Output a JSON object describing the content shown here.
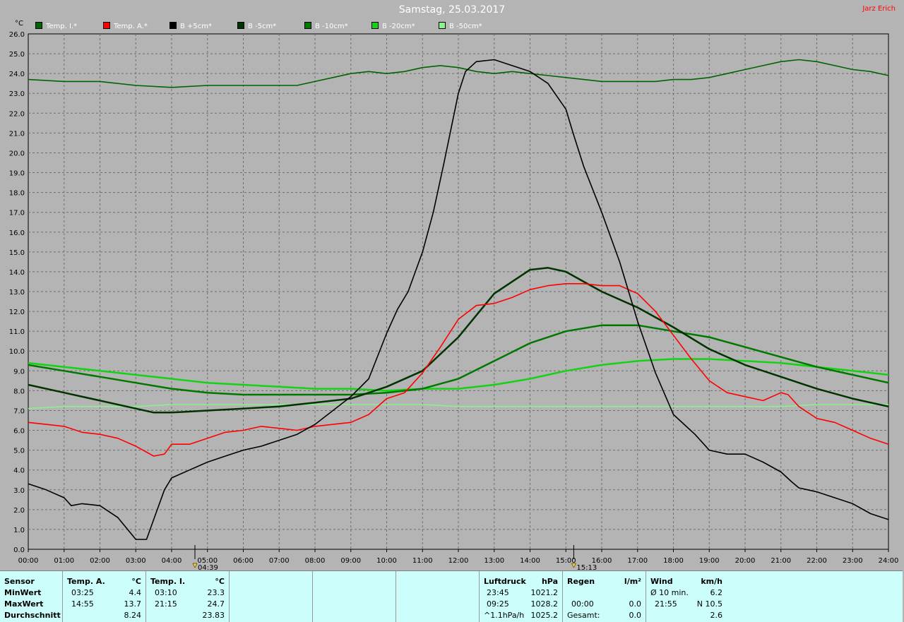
{
  "header": {
    "title": "Samstag, 25.03.2017",
    "author": "Jarz Erich"
  },
  "legend": [
    {
      "name": "Temp. I.*",
      "color": "#006400"
    },
    {
      "name": "Temp. A.*",
      "color": "#ff0000"
    },
    {
      "name": "B +5cm*",
      "color": "#000000"
    },
    {
      "name": "B -5cm*",
      "color": "#003300"
    },
    {
      "name": "B -10cm*",
      "color": "#007800"
    },
    {
      "name": "B -20cm*",
      "color": "#14d214"
    },
    {
      "name": "B -50cm*",
      "color": "#8cf08c"
    }
  ],
  "chart_data": {
    "type": "line",
    "ylabel": "°C",
    "ylim": [
      0,
      26
    ],
    "xlim": [
      0,
      24
    ],
    "grid": true,
    "y_ticks": [
      "0.0",
      "1.0",
      "2.0",
      "3.0",
      "4.0",
      "5.0",
      "6.0",
      "7.0",
      "8.0",
      "9.0",
      "10.0",
      "11.0",
      "12.0",
      "13.0",
      "14.0",
      "15.0",
      "16.0",
      "17.0",
      "18.0",
      "19.0",
      "20.0",
      "21.0",
      "22.0",
      "23.0",
      "24.0",
      "25.0",
      "26.0"
    ],
    "x_ticks": [
      "00:00",
      "01:00",
      "02:00",
      "03:00",
      "04:00",
      "05:00",
      "06:00",
      "07:00",
      "08:00",
      "09:00",
      "10:00",
      "11:00",
      "12:00",
      "13:00",
      "14:00",
      "15:00",
      "16:00",
      "17:00",
      "18:00",
      "19:00",
      "20:00",
      "21:00",
      "22:00",
      "23:00",
      "24:00"
    ],
    "markers": [
      {
        "label": "04:39",
        "x": 4.65,
        "icon": "sunrise-icon"
      },
      {
        "label": "15:13",
        "x": 15.22,
        "icon": "sunset-icon"
      }
    ],
    "series": [
      {
        "name": "Temp. I.*",
        "color": "#006400",
        "x": [
          0,
          1,
          2,
          3,
          4,
          5,
          6,
          7,
          7.5,
          8,
          8.5,
          9,
          9.5,
          10,
          10.5,
          11,
          11.5,
          12,
          12.5,
          13,
          13.5,
          14,
          14.5,
          15,
          15.5,
          16,
          16.5,
          17,
          17.5,
          18,
          18.5,
          19,
          19.5,
          20,
          20.5,
          21,
          21.5,
          22,
          22.5,
          23,
          23.5,
          24
        ],
        "y": [
          23.7,
          23.6,
          23.6,
          23.4,
          23.3,
          23.4,
          23.4,
          23.4,
          23.4,
          23.6,
          23.8,
          24.0,
          24.1,
          24.0,
          24.1,
          24.3,
          24.4,
          24.3,
          24.1,
          24.0,
          24.1,
          24.0,
          23.9,
          23.8,
          23.7,
          23.6,
          23.6,
          23.6,
          23.6,
          23.7,
          23.7,
          23.8,
          24.0,
          24.2,
          24.4,
          24.6,
          24.7,
          24.6,
          24.4,
          24.2,
          24.1,
          23.9
        ]
      },
      {
        "name": "Temp. A.*",
        "color": "#ff0000",
        "x": [
          0,
          0.5,
          1,
          1.5,
          2,
          2.5,
          3,
          3.5,
          3.8,
          4,
          4.5,
          5,
          5.5,
          6,
          6.5,
          7,
          7.5,
          8,
          8.5,
          9,
          9.5,
          10,
          10.5,
          11,
          11.5,
          12,
          12.5,
          13,
          13.5,
          14,
          14.5,
          15,
          15.5,
          16,
          16.5,
          17,
          17.5,
          18,
          18.5,
          19,
          19.5,
          20,
          20.5,
          21,
          21.2,
          21.5,
          22,
          22.5,
          23,
          23.5,
          24
        ],
        "y": [
          6.4,
          6.3,
          6.2,
          5.9,
          5.8,
          5.6,
          5.2,
          4.7,
          4.8,
          5.3,
          5.3,
          5.6,
          5.9,
          6.0,
          6.2,
          6.1,
          6.0,
          6.2,
          6.3,
          6.4,
          6.8,
          7.6,
          7.9,
          8.9,
          10.2,
          11.6,
          12.3,
          12.4,
          12.7,
          13.1,
          13.3,
          13.4,
          13.4,
          13.3,
          13.3,
          12.9,
          12.0,
          10.8,
          9.6,
          8.5,
          7.9,
          7.7,
          7.5,
          7.9,
          7.8,
          7.2,
          6.6,
          6.4,
          6.0,
          5.6,
          5.3
        ]
      },
      {
        "name": "B +5cm*",
        "color": "#000000",
        "x": [
          0,
          0.5,
          1,
          1.2,
          1.5,
          2,
          2.5,
          3,
          3.3,
          3.5,
          3.8,
          4,
          4.5,
          5,
          5.5,
          6,
          6.5,
          7,
          7.5,
          8,
          8.5,
          9,
          9.5,
          10,
          10.3,
          10.6,
          11,
          11.3,
          11.6,
          12,
          12.2,
          12.5,
          13,
          13.5,
          14,
          14.5,
          15,
          15.2,
          15.5,
          16,
          16.5,
          17,
          17.5,
          18,
          18.3,
          18.6,
          19,
          19.5,
          20,
          20.5,
          21,
          21.3,
          21.5,
          22,
          22.5,
          23,
          23.5,
          24
        ],
        "y": [
          3.3,
          3.0,
          2.6,
          2.2,
          2.3,
          2.2,
          1.6,
          0.5,
          0.5,
          1.5,
          3.0,
          3.6,
          4.0,
          4.4,
          4.7,
          5.0,
          5.2,
          5.5,
          5.8,
          6.3,
          7.0,
          7.7,
          8.6,
          10.9,
          12.1,
          13.0,
          15.0,
          17.0,
          19.5,
          23.0,
          24.1,
          24.6,
          24.7,
          24.4,
          24.1,
          23.5,
          22.2,
          21.0,
          19.3,
          17.0,
          14.5,
          11.5,
          8.9,
          6.8,
          6.3,
          5.8,
          5.0,
          4.8,
          4.8,
          4.4,
          3.9,
          3.4,
          3.1,
          2.9,
          2.6,
          2.3,
          1.8,
          1.5
        ]
      },
      {
        "name": "B -5cm*",
        "color": "#003300",
        "x": [
          0,
          1,
          2,
          3,
          3.5,
          4,
          5,
          6,
          7,
          8,
          9,
          10,
          11,
          12,
          13,
          14,
          14.5,
          15,
          15.5,
          16,
          17,
          18,
          19,
          20,
          21,
          22,
          23,
          24
        ],
        "y": [
          8.3,
          7.9,
          7.5,
          7.1,
          6.9,
          6.9,
          7.0,
          7.1,
          7.2,
          7.4,
          7.6,
          8.2,
          9.0,
          10.7,
          12.9,
          14.1,
          14.2,
          14.0,
          13.5,
          13.0,
          12.2,
          11.2,
          10.1,
          9.3,
          8.7,
          8.1,
          7.6,
          7.2
        ]
      },
      {
        "name": "B -10cm*",
        "color": "#007800",
        "x": [
          0,
          1,
          2,
          3,
          4,
          5,
          6,
          7,
          8,
          9,
          10,
          11,
          12,
          13,
          14,
          15,
          16,
          17,
          18,
          19,
          20,
          21,
          22,
          23,
          24
        ],
        "y": [
          9.3,
          9.0,
          8.7,
          8.4,
          8.1,
          7.9,
          7.8,
          7.8,
          7.8,
          7.8,
          7.9,
          8.1,
          8.6,
          9.5,
          10.4,
          11.0,
          11.3,
          11.3,
          11.0,
          10.7,
          10.2,
          9.7,
          9.2,
          8.8,
          8.4
        ]
      },
      {
        "name": "B -20cm*",
        "color": "#14d214",
        "x": [
          0,
          1,
          2,
          3,
          4,
          5,
          6,
          7,
          8,
          9,
          10,
          11,
          12,
          13,
          14,
          15,
          16,
          17,
          18,
          19,
          20,
          21,
          22,
          23,
          24
        ],
        "y": [
          9.4,
          9.2,
          9.0,
          8.8,
          8.6,
          8.4,
          8.3,
          8.2,
          8.1,
          8.1,
          8.0,
          8.1,
          8.1,
          8.3,
          8.6,
          9.0,
          9.3,
          9.5,
          9.6,
          9.6,
          9.5,
          9.4,
          9.2,
          9.0,
          8.8
        ]
      },
      {
        "name": "B -50cm*",
        "color": "#8cf08c",
        "x": [
          0,
          1,
          2,
          3,
          4,
          5,
          6,
          7,
          8,
          9,
          10,
          11,
          12,
          13,
          14,
          15,
          16,
          17,
          18,
          19,
          20,
          21,
          22,
          23,
          24
        ],
        "y": [
          7.1,
          7.2,
          7.2,
          7.2,
          7.3,
          7.3,
          7.3,
          7.3,
          7.3,
          7.3,
          7.3,
          7.3,
          7.2,
          7.2,
          7.2,
          7.2,
          7.2,
          7.2,
          7.2,
          7.2,
          7.2,
          7.2,
          7.3,
          7.3,
          7.3
        ]
      }
    ]
  },
  "table": {
    "sensor_col": {
      "header": "Sensor",
      "rows": [
        "MinWert",
        "MaxWert",
        "Durchschnitt"
      ]
    },
    "temp_a": {
      "header": "Temp. A.",
      "unit": "°C",
      "rows": [
        [
          "03:25",
          "4.4"
        ],
        [
          "14:55",
          "13.7"
        ],
        [
          "",
          "8.24"
        ]
      ]
    },
    "temp_i": {
      "header": "Temp. I.",
      "unit": "°C",
      "rows": [
        [
          "03:10",
          "23.3"
        ],
        [
          "21:15",
          "24.7"
        ],
        [
          "",
          "23.83"
        ]
      ]
    },
    "luftdruck": {
      "header": "Luftdruck",
      "unit": "hPa",
      "rows": [
        [
          "23:45",
          "1021.2"
        ],
        [
          "09:25",
          "1028.2"
        ],
        [
          "^1.1hPa/h",
          "1025.2"
        ]
      ]
    },
    "regen": {
      "header": "Regen",
      "unit": "l/m²",
      "rows": [
        [
          "",
          ""
        ],
        [
          "00:00",
          "0.0"
        ],
        [
          "Gesamt:",
          "0.0"
        ]
      ],
      "first_value": "0.0"
    },
    "wind": {
      "header": "Wind",
      "unit": "km/h",
      "rows": [
        [
          "Ø 10 min.",
          "6.2"
        ],
        [
          "21:55",
          "N 10.5"
        ],
        [
          "",
          "2.6"
        ]
      ]
    }
  }
}
